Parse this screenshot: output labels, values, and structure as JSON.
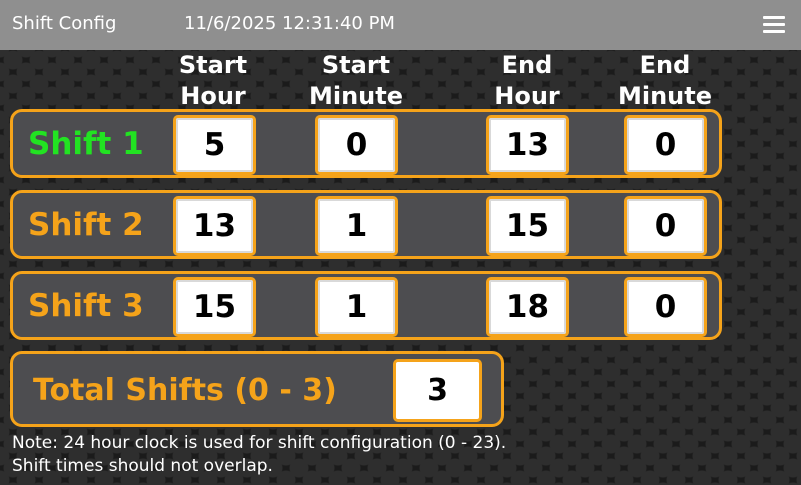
{
  "header": {
    "title": "Shift Config",
    "datetime": "11/6/2025 12:31:40 PM",
    "menu_icon": "hamburger-menu-icon"
  },
  "columns": [
    {
      "line1": "Start",
      "line2": "Hour"
    },
    {
      "line1": "Start",
      "line2": "Minute"
    },
    {
      "line1": "End",
      "line2": "Hour"
    },
    {
      "line1": "End",
      "line2": "Minute"
    }
  ],
  "shifts": [
    {
      "label": "Shift 1",
      "start_hour": "5",
      "start_minute": "0",
      "end_hour": "13",
      "end_minute": "0"
    },
    {
      "label": "Shift 2",
      "start_hour": "13",
      "start_minute": "1",
      "end_hour": "15",
      "end_minute": "0"
    },
    {
      "label": "Shift 3",
      "start_hour": "15",
      "start_minute": "1",
      "end_hour": "18",
      "end_minute": "0"
    }
  ],
  "total": {
    "label": "Total Shifts (0 - 3)",
    "value": "3"
  },
  "note": {
    "line1": "Note: 24 hour clock is used for shift configuration (0 - 23).",
    "line2": "Shift times should not overlap."
  },
  "colors": {
    "accent": "#f5a31a",
    "active_shift": "#22e322",
    "header_bg": "#8f8f8f",
    "row_bg": "#4d4d50"
  }
}
